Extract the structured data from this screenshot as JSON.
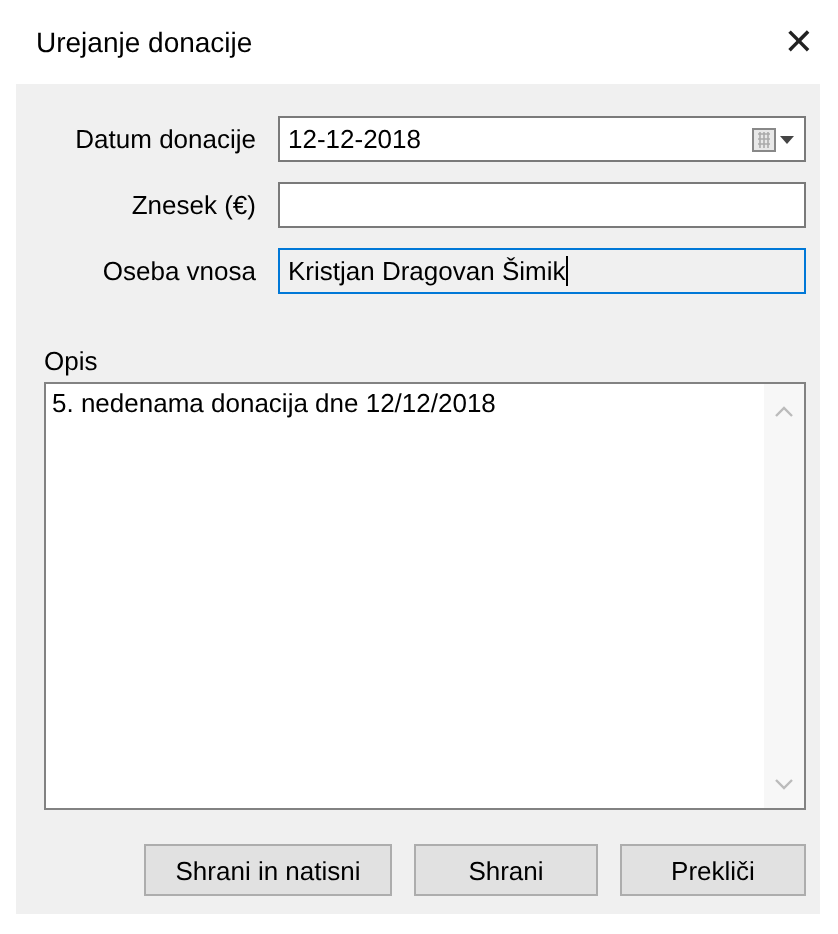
{
  "window": {
    "title": "Urejanje donacije",
    "close": "✕"
  },
  "fields": [
    {
      "kind": "date",
      "label": "Datum donacije",
      "value": "12-12-2018",
      "focused": false,
      "readonly": false
    },
    {
      "kind": "text",
      "label": "Znesek (€)",
      "focused": false,
      "readonly": false
    },
    {
      "kind": "text",
      "label": "Oseba vnosa",
      "value": "Kristjan Dragovan Šimik",
      "focused": true,
      "readonly": true
    }
  ],
  "description": {
    "label": "Opis",
    "value": "5. nedenama donacija dne 12/12/2018"
  },
  "buttons": [
    "Shrani in natisni",
    "Shrani",
    "Prekliči"
  ]
}
